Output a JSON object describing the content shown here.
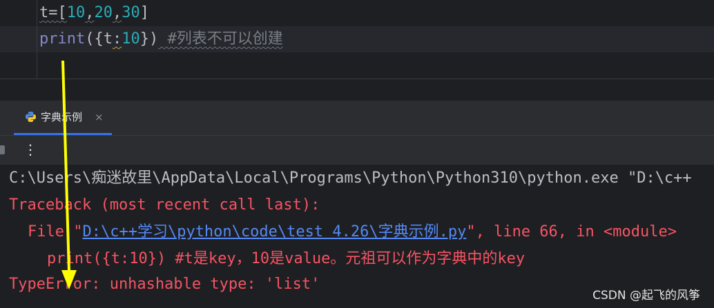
{
  "editor": {
    "line1": {
      "t1": "t=[",
      "n1": "10",
      "c1": ",",
      "n2": "20",
      "c2": ",",
      "n3": "30",
      "close": "]"
    },
    "line2": {
      "fn": "print",
      "open": "({",
      "var": "t",
      "colon": ":",
      "num": "10",
      "close": "})",
      "comment": " #列表不可以创建"
    }
  },
  "run_panel": {
    "tab_label": "字典示例",
    "close_glyph": "×",
    "more_glyph": "⋮"
  },
  "console": {
    "cmd_line": "C:\\Users\\痴迷故里\\AppData\\Local\\Programs\\Python\\Python310\\python.exe \"D:\\c++",
    "traceback": "Traceback (most recent call last):",
    "file_prefix": "File \"",
    "file_link": "D:\\c++学习\\python\\code\\test 4.26\\字典示例.py",
    "file_suffix": "\", line 66, in <module>",
    "source_line": "print({t:10}) #t是key，10是value。元祖可以作为字典中的key",
    "error_line": "TypeError: unhashable type: 'list'"
  },
  "watermark": "CSDN @起飞的风筝",
  "colors": {
    "background": "#1e1f22",
    "error_red": "#f75464",
    "link_blue": "#548af7",
    "number_cyan": "#2aacb8",
    "arrow_yellow": "#ffff00"
  }
}
